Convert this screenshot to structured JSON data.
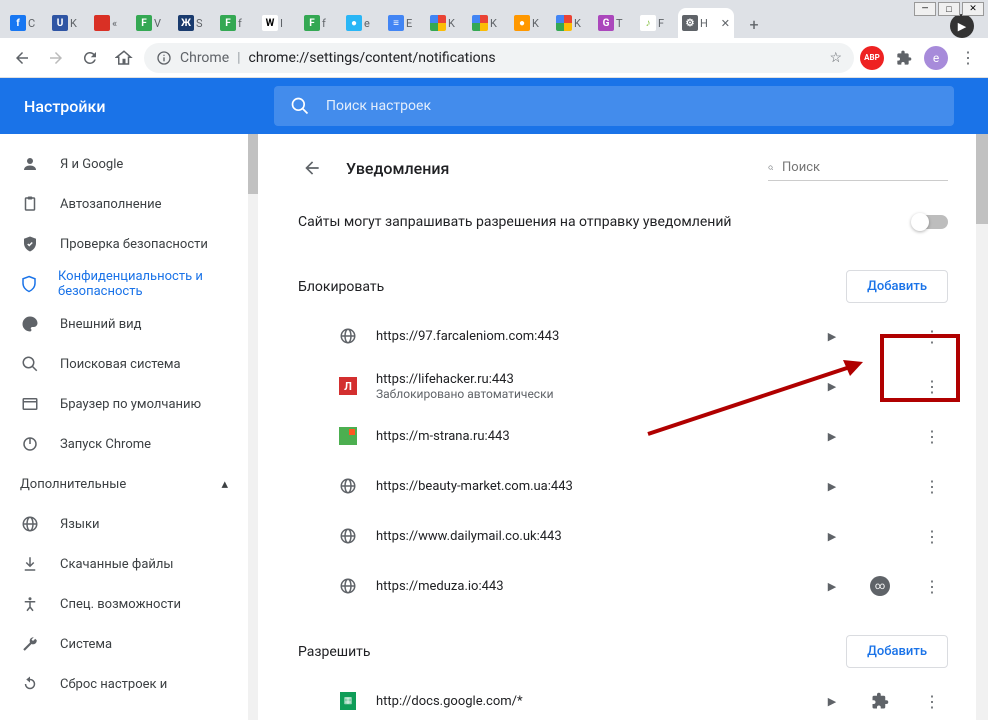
{
  "window": {
    "min": "—",
    "max": "□",
    "close": "✕"
  },
  "tabs": [
    {
      "label": "C",
      "color": "#1877f2",
      "txt": "f"
    },
    {
      "label": "K",
      "color": "#2f55a4",
      "txt": "U"
    },
    {
      "label": "«",
      "color": "#d93025",
      "txt": ""
    },
    {
      "label": "V",
      "color": "#34a853",
      "txt": "F"
    },
    {
      "label": "S",
      "color": "#1a3b6e",
      "txt": "Ж"
    },
    {
      "label": "f",
      "color": "#34a853",
      "txt": "F"
    },
    {
      "label": "I",
      "color": "#fff",
      "txt": "W",
      "fg": "#000"
    },
    {
      "label": "f",
      "color": "#34a853",
      "txt": "F"
    },
    {
      "label": "e",
      "color": "#29b6f6",
      "txt": "●"
    },
    {
      "label": "E",
      "color": "#4285f4",
      "txt": "≡"
    },
    {
      "label": "K",
      "color": "#fff",
      "txt": "G",
      "multi": true
    },
    {
      "label": "K",
      "color": "#fff",
      "txt": "●",
      "multi": true
    },
    {
      "label": "K",
      "color": "#ff9800",
      "txt": "●"
    },
    {
      "label": "K",
      "color": "#fff",
      "txt": "●",
      "multi": true
    },
    {
      "label": "T",
      "color": "#ab47bc",
      "txt": "G"
    },
    {
      "label": "F",
      "color": "#fff",
      "txt": "♪",
      "fg": "#8bc34a"
    }
  ],
  "active_tab": {
    "label": "Н",
    "close": "✕"
  },
  "toolbar": {
    "chrome_label": "Chrome",
    "url": "chrome://settings/content/notifications"
  },
  "header": {
    "title": "Настройки",
    "search_placeholder": "Поиск настроек"
  },
  "sidebar": {
    "items": [
      {
        "icon": "person",
        "label": "Я и Google"
      },
      {
        "icon": "clipboard",
        "label": "Автозаполнение"
      },
      {
        "icon": "shield-check",
        "label": "Проверка безопасности"
      },
      {
        "icon": "shield",
        "label": "Конфиденциальность и безопасность",
        "active": true
      },
      {
        "icon": "palette",
        "label": "Внешний вид"
      },
      {
        "icon": "search",
        "label": "Поисковая система"
      },
      {
        "icon": "window",
        "label": "Браузер по умолчанию"
      },
      {
        "icon": "power",
        "label": "Запуск Chrome"
      }
    ],
    "section": "Дополнительные",
    "more": [
      {
        "icon": "globe",
        "label": "Языки"
      },
      {
        "icon": "download",
        "label": "Скачанные файлы"
      },
      {
        "icon": "accessibility",
        "label": "Спец. возможности"
      },
      {
        "icon": "wrench",
        "label": "Система"
      },
      {
        "icon": "reset",
        "label": "Сброс настроек и"
      }
    ]
  },
  "page": {
    "title": "Уведомления",
    "search_placeholder": "Поиск",
    "toggle_label": "Сайты могут запрашивать разрешения на отправку уведомлений",
    "block_label": "Блокировать",
    "allow_label": "Разрешить",
    "add_label": "Добавить",
    "blocked": [
      {
        "icon": "globe",
        "url": "https://97.farcaleniom.com:443"
      },
      {
        "icon": "red-L",
        "url": "https://lifehacker.ru:443",
        "sub": "Заблокировано автоматически"
      },
      {
        "icon": "green-sq",
        "url": "https://m-strana.ru:443"
      },
      {
        "icon": "globe",
        "url": "https://beauty-market.com.ua:443"
      },
      {
        "icon": "globe",
        "url": "https://www.dailymail.co.uk:443"
      },
      {
        "icon": "globe",
        "url": "https://meduza.io:443",
        "incognito": true
      }
    ],
    "allowed": [
      {
        "icon": "green-doc",
        "url": "http://docs.google.com/*",
        "ext": true
      }
    ]
  }
}
